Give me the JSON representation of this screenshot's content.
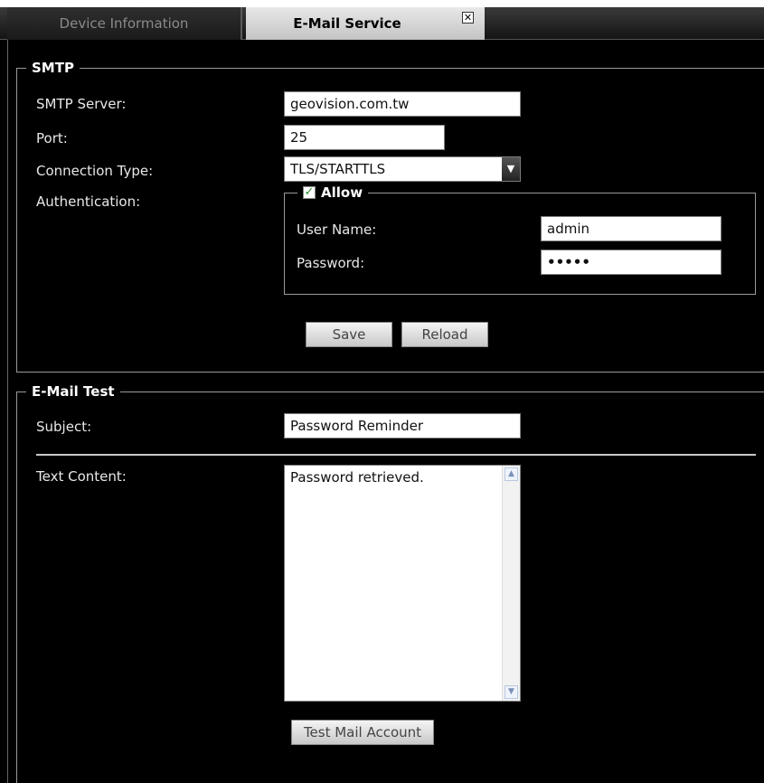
{
  "tabs": {
    "device_info": "Device Information",
    "email_service": "E-Mail Service",
    "close_glyph": "✕"
  },
  "smtp": {
    "legend": "SMTP",
    "server_label": "SMTP Server:",
    "server_value": "geovision.com.tw",
    "port_label": "Port:",
    "port_value": "25",
    "connection_label": "Connection Type:",
    "connection_value": "TLS/STARTTLS",
    "auth_label": "Authentication:",
    "allow_label": "Allow",
    "allow_checked": true,
    "username_label": "User Name:",
    "username_value": "admin",
    "password_label": "Password:",
    "password_value": "•••••",
    "save_label": "Save",
    "reload_label": "Reload"
  },
  "test": {
    "legend": "E-Mail Test",
    "subject_label": "Subject:",
    "subject_value": "Password Reminder",
    "content_label": "Text Content:",
    "content_value": "Password retrieved.",
    "test_button": "Test Mail Account"
  },
  "colors": {
    "background": "#000000",
    "active_tab": "#d8d8d8",
    "check_green": "#2b8a2b"
  }
}
